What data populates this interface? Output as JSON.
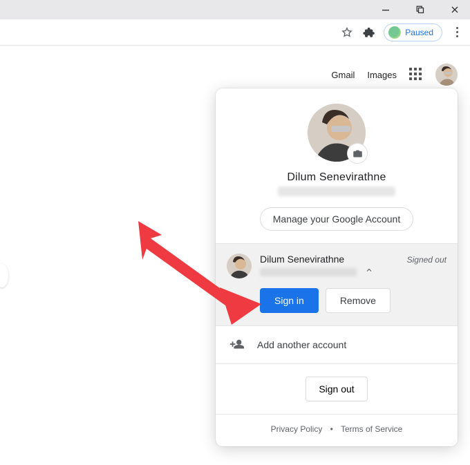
{
  "window_controls": {
    "minimize": "minimize",
    "maximize": "maximize",
    "close": "close"
  },
  "toolbar": {
    "paused_label": "Paused"
  },
  "nav": {
    "gmail": "Gmail",
    "images": "Images"
  },
  "popover": {
    "name": "Dilum Senevirathne",
    "manage": "Manage your Google Account",
    "other_account": {
      "name": "Dilum Senevirathne",
      "status": "Signed out",
      "sign_in": "Sign in",
      "remove": "Remove"
    },
    "add_account": "Add another account",
    "sign_out": "Sign out",
    "privacy": "Privacy Policy",
    "dot": "•",
    "terms": "Terms of Service"
  }
}
